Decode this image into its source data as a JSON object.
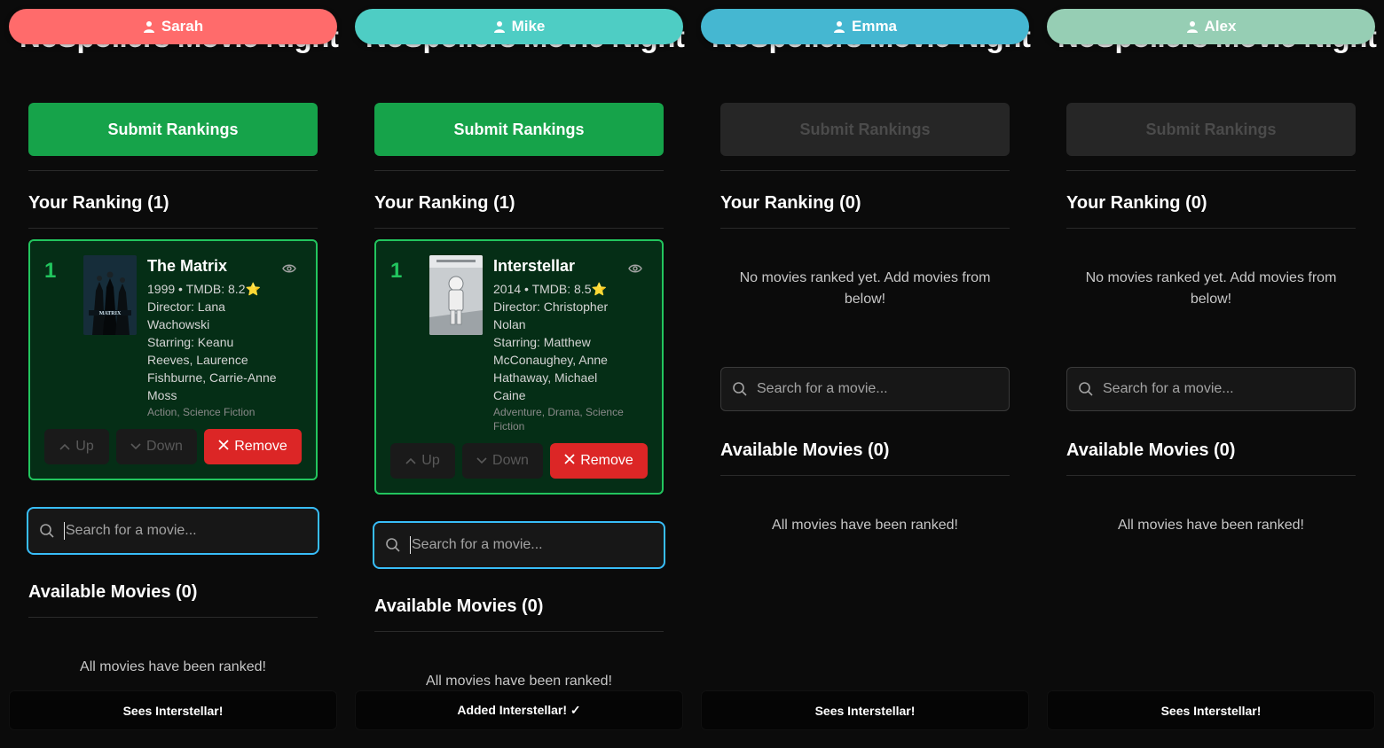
{
  "app_title": "NoSpoilers Movie Night",
  "panels": [
    {
      "user": "Sarah",
      "submit_label": "Submit Rankings",
      "ranking_header": "Your Ranking (1)",
      "ranked": [
        {
          "rank": "1",
          "title": "The Matrix",
          "meta": "1999 • TMDB: 8.2⭐",
          "director": "Director: Lana Wachowski",
          "starring": "Starring: Keanu Reeves, Laurence Fishburne, Carrie-Anne Moss",
          "genres": "Action, Science Fiction",
          "up_label": "Up",
          "down_label": "Down",
          "remove_label": "Remove"
        }
      ],
      "empty_ranking": "",
      "search_placeholder": "Search for a movie...",
      "available_header": "Available Movies (0)",
      "available_empty": "All movies have been ranked!",
      "toast": "Sees Interstellar!"
    },
    {
      "user": "Mike",
      "submit_label": "Submit Rankings",
      "ranking_header": "Your Ranking (1)",
      "ranked": [
        {
          "rank": "1",
          "title": "Interstellar",
          "meta": "2014 • TMDB: 8.5⭐",
          "director": "Director: Christopher Nolan",
          "starring": "Starring: Matthew McConaughey, Anne Hathaway, Michael Caine",
          "genres": "Adventure, Drama, Science Fiction",
          "up_label": "Up",
          "down_label": "Down",
          "remove_label": "Remove"
        }
      ],
      "empty_ranking": "",
      "search_placeholder": "Search for a movie...",
      "available_header": "Available Movies (0)",
      "available_empty": "All movies have been ranked!",
      "toast": "Added Interstellar! ✓"
    },
    {
      "user": "Emma",
      "submit_label": "Submit Rankings",
      "ranking_header": "Your Ranking (0)",
      "ranked": [],
      "empty_ranking": "No movies ranked yet. Add movies from below!",
      "search_placeholder": "Search for a movie...",
      "available_header": "Available Movies (0)",
      "available_empty": "All movies have been ranked!",
      "toast": "Sees Interstellar!"
    },
    {
      "user": "Alex",
      "submit_label": "Submit Rankings",
      "ranking_header": "Your Ranking (0)",
      "ranked": [],
      "empty_ranking": "No movies ranked yet. Add movies from below!",
      "search_placeholder": "Search for a movie...",
      "available_header": "Available Movies (0)",
      "available_empty": "All movies have been ranked!",
      "toast": "Sees Interstellar!"
    }
  ],
  "colors": {
    "sarah": "#ff6b6b",
    "mike": "#4ecdc4",
    "emma": "#45b7d1",
    "alex": "#96ceb4",
    "submit_active": "#16a34a",
    "rank_accent": "#22c55e",
    "remove": "#dc2626",
    "focus_ring": "#38bdf8"
  },
  "icons": {
    "user": "user-icon",
    "search": "search-icon",
    "eye": "eye-icon",
    "up": "chevron-up-icon",
    "down": "chevron-down-icon",
    "remove": "close-icon"
  }
}
